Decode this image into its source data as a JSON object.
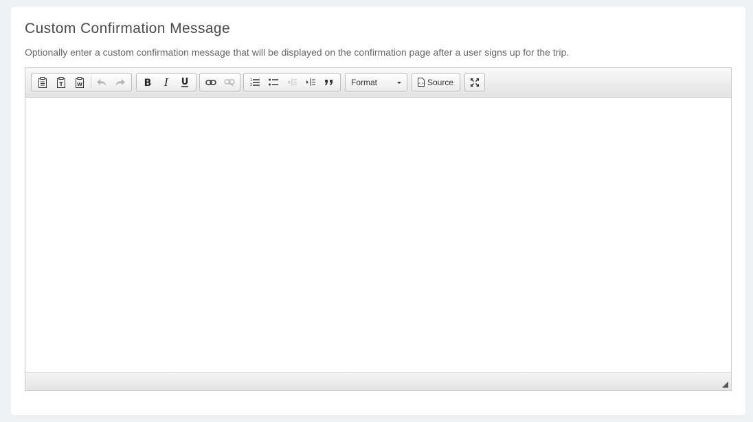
{
  "section": {
    "title": "Custom Confirmation Message",
    "description": "Optionally enter a custom confirmation message that will be displayed on the confirmation page after a user signs up for the trip."
  },
  "toolbar": {
    "clipboard": [
      "paste-icon",
      "paste-text-icon",
      "paste-word-icon"
    ],
    "history": [
      "undo-icon",
      "redo-icon"
    ],
    "basicstyles": [
      "bold-icon",
      "italic-icon",
      "underline-icon"
    ],
    "links": [
      "link-icon",
      "unlink-icon"
    ],
    "paragraph": [
      "numbered-list-icon",
      "bulleted-list-icon",
      "outdent-icon",
      "indent-icon",
      "blockquote-icon"
    ],
    "format_label": "Format",
    "source_label": "Source",
    "maximize": "maximize-icon"
  },
  "editor": {
    "content": ""
  }
}
